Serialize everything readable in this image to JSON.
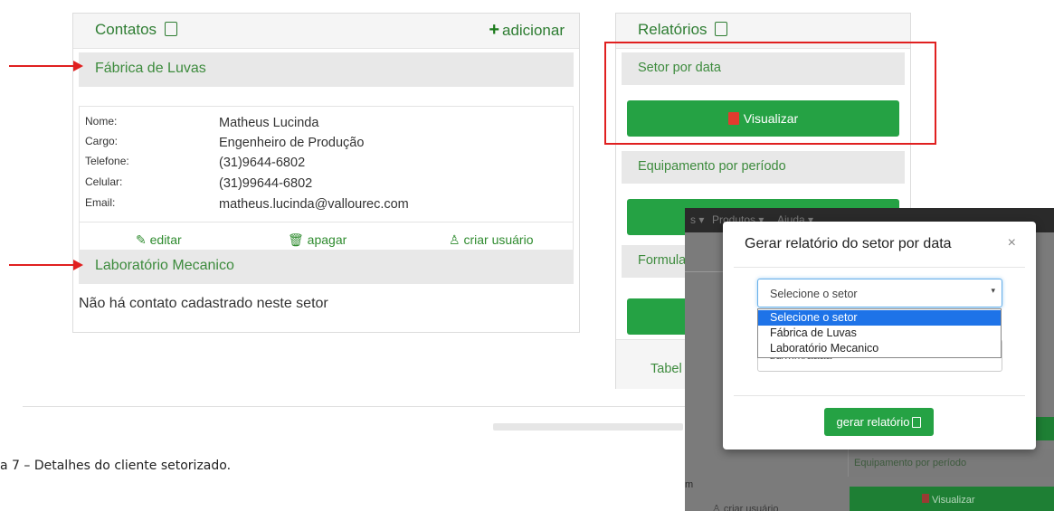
{
  "contacts": {
    "title": "Contatos",
    "add_label": "adicionar",
    "sectors": [
      {
        "name": "Fábrica de Luvas",
        "contact": {
          "fields": [
            {
              "label": "Nome:",
              "value": "Matheus Lucinda"
            },
            {
              "label": "Cargo:",
              "value": "Engenheiro de Produção"
            },
            {
              "label": "Telefone:",
              "value": "(31)9644-6802"
            },
            {
              "label": "Celular:",
              "value": "(31)99644-6802"
            },
            {
              "label": "Email:",
              "value": "matheus.lucinda@vallourec.com"
            }
          ],
          "actions": {
            "edit": "editar",
            "delete": "apagar",
            "create_user": "criar usuário"
          }
        }
      },
      {
        "name": "Laboratório Mecanico",
        "empty_message": "Não há contato cadastrado neste setor"
      }
    ]
  },
  "reports": {
    "title": "Relatórios",
    "items": [
      {
        "label": "Setor por data",
        "button": "Visualizar"
      },
      {
        "label": "Equipamento por período"
      },
      {
        "label": "Formula"
      },
      {
        "label": "Tabel"
      }
    ]
  },
  "background": {
    "nav_items": [
      "s ▾",
      "Produtos ▾",
      "Ajuda ▾"
    ],
    "sector_label": "Equipamento por período",
    "button": "Visualizar",
    "create_user": "criar usuário",
    "fragment": "m"
  },
  "modal": {
    "title": "Gerar relatório do setor por data",
    "close": "×",
    "select_value": "Selecione o setor",
    "options": [
      "Selecione o setor",
      "Fábrica de Luvas",
      "Laboratório Mecanico"
    ],
    "date_placeholder": "dd/mm/aaaa",
    "submit": "gerar relatório"
  },
  "caption": "a 7 – Detalhes do cliente setorizado.",
  "colors": {
    "accent_green": "#25a244",
    "highlight_red": "#e02020",
    "text_green": "#2e7d32"
  }
}
